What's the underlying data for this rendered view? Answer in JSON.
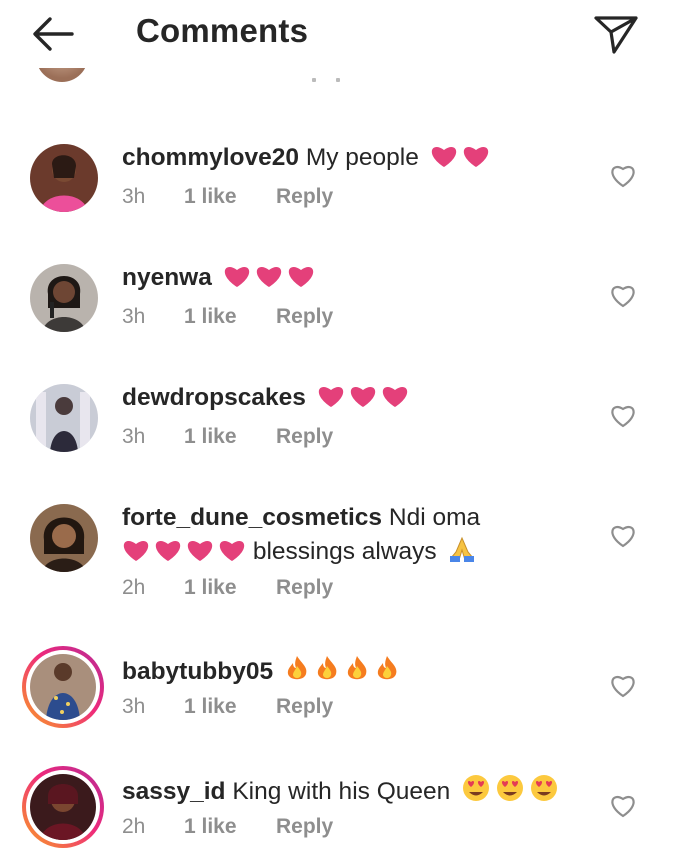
{
  "header": {
    "title": "Comments",
    "back_icon": "arrow-left-icon",
    "share_icon": "paper-plane-icon"
  },
  "colors": {
    "heart": "#e4407a",
    "meta": "#8e8e8e",
    "text": "#262626"
  },
  "comments": [
    {
      "username": "chommylove20",
      "text": "My people",
      "emoji": "pink-heart x2",
      "time": "3h",
      "likes": "1 like",
      "reply": "Reply"
    },
    {
      "username": "nyenwa",
      "text": "",
      "emoji": "pink-heart x3",
      "time": "3h",
      "likes": "1 like",
      "reply": "Reply"
    },
    {
      "username": "dewdropscakes",
      "text": "",
      "emoji": "pink-heart x3",
      "time": "3h",
      "likes": "1 like",
      "reply": "Reply"
    },
    {
      "username": "forte_dune_cosmetics",
      "text": "Ndi oma",
      "text2": "blessings always",
      "emoji": "pink-heart x4, praying-hands",
      "time": "2h",
      "likes": "1 like",
      "reply": "Reply"
    },
    {
      "username": "babytubby05",
      "text": "",
      "emoji": "fire x4",
      "time": "3h",
      "likes": "1 like",
      "reply": "Reply"
    },
    {
      "username": "sassy_id",
      "text": "King with his Queen",
      "emoji": "heart-eyes x3",
      "time": "2h",
      "likes": "1 like",
      "reply": "Reply"
    }
  ]
}
